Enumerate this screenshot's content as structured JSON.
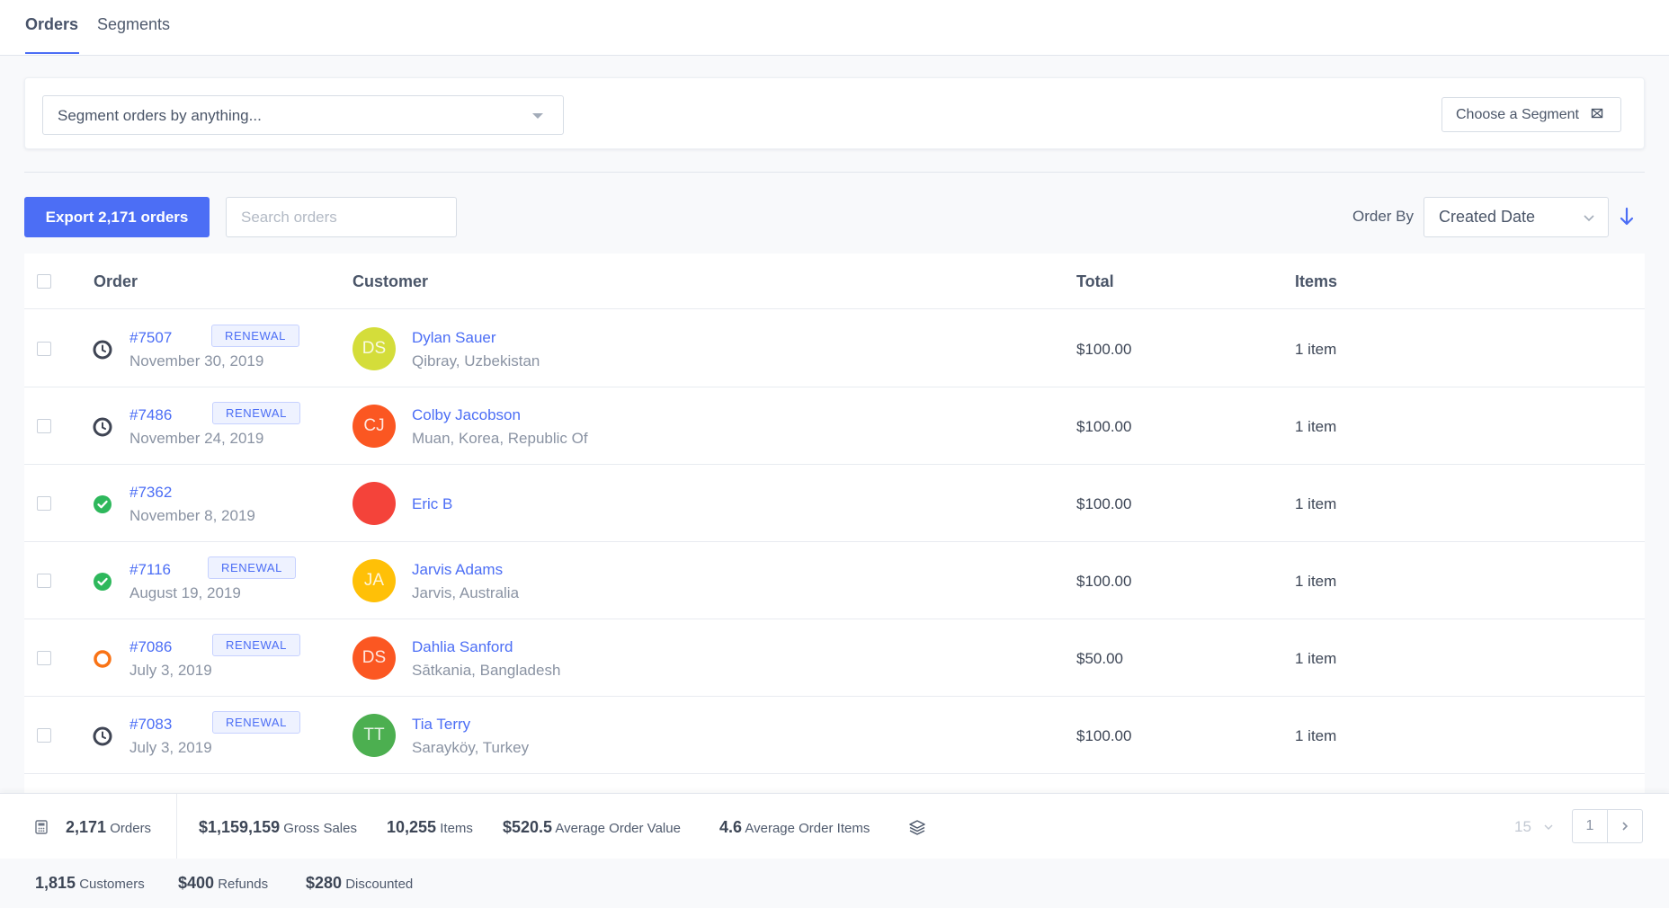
{
  "tabs": {
    "orders": "Orders",
    "segments": "Segments"
  },
  "segment": {
    "placeholder": "Segment orders by anything...",
    "choose_label": "Choose a Segment"
  },
  "toolbar": {
    "export_label": "Export 2,171 orders",
    "search_placeholder": "Search orders",
    "order_by_label": "Order By",
    "order_by_value": "Created Date"
  },
  "table": {
    "headers": {
      "order": "Order",
      "customer": "Customer",
      "total": "Total",
      "items": "Items"
    },
    "rows": [
      {
        "order": "#7507",
        "badge": "RENEWAL",
        "date": "November 30, 2019",
        "status_icon": "clock-icon",
        "initials": "DS",
        "avatar_color": "#d4dd3a",
        "name": "Dylan Sauer",
        "location": "Qibray, Uzbekistan",
        "total": "$100.00",
        "items": "1 item"
      },
      {
        "order": "#7486",
        "badge": "RENEWAL",
        "date": "November 24, 2019",
        "status_icon": "clock-icon",
        "initials": "CJ",
        "avatar_color": "#fb5722",
        "name": "Colby Jacobson",
        "location": "Muan, Korea, Republic Of",
        "total": "$100.00",
        "items": "1 item"
      },
      {
        "order": "#7362",
        "badge": "",
        "date": "November 8, 2019",
        "status_icon": "check-circle-icon",
        "initials": "",
        "avatar_color": "#f4433a",
        "name": "Eric B",
        "location": "",
        "total": "$100.00",
        "items": "1 item"
      },
      {
        "order": "#7116",
        "badge": "RENEWAL",
        "date": "August 19, 2019",
        "status_icon": "check-circle-icon",
        "initials": "JA",
        "avatar_color": "#ffc007",
        "name": "Jarvis Adams",
        "location": "Jarvis, Australia",
        "total": "$100.00",
        "items": "1 item"
      },
      {
        "order": "#7086",
        "badge": "RENEWAL",
        "date": "July 3, 2019",
        "status_icon": "processing-ring-icon",
        "initials": "DS",
        "avatar_color": "#fb5722",
        "name": "Dahlia Sanford",
        "location": "Sātkania, Bangladesh",
        "total": "$50.00",
        "items": "1 item"
      },
      {
        "order": "#7083",
        "badge": "RENEWAL",
        "date": "July 3, 2019",
        "status_icon": "clock-icon",
        "initials": "TT",
        "avatar_color": "#4caf50",
        "name": "Tia Terry",
        "location": "Sarayköy, Turkey",
        "total": "$100.00",
        "items": "1 item"
      }
    ]
  },
  "stats": {
    "orders_value": "2,171",
    "orders_label": "Orders",
    "gross_value": "$1,159,159",
    "gross_label": "Gross Sales",
    "items_value": "10,255",
    "items_label": "Items",
    "aov_value": "$520.5",
    "aov_label": "Average Order Value",
    "aoi_value": "4.6",
    "aoi_label": "Average Order Items",
    "per_page": "15",
    "page": "1",
    "customers_value": "1,815",
    "customers_label": "Customers",
    "refunds_value": "$400",
    "refunds_label": "Refunds",
    "discounted_value": "$280",
    "discounted_label": "Discounted"
  },
  "colors": {
    "accent": "#4c6ef5",
    "success": "#2eb85c",
    "warning": "#f97316",
    "neutral_icon": "#3f4554"
  }
}
